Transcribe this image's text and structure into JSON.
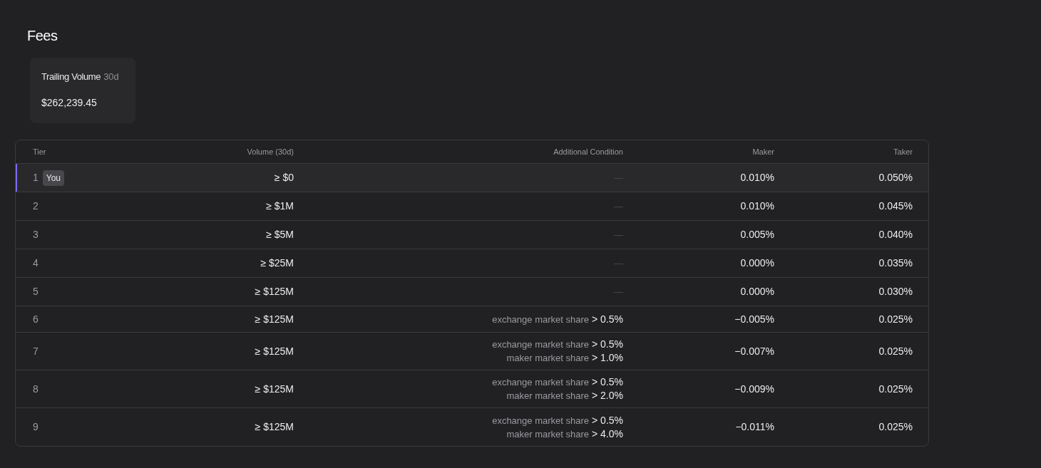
{
  "title": "Fees",
  "volume_card": {
    "label": "Trailing Volume",
    "period": "30d",
    "value": "$262,239.45"
  },
  "table": {
    "columns": [
      "Tier",
      "Volume (30d)",
      "Additional Condition",
      "Maker",
      "Taker"
    ],
    "rows": [
      {
        "tier": "1",
        "badge": "You",
        "selected": true,
        "volume": "≥ $0",
        "condition": "—",
        "conditions": [],
        "maker": "0.010%",
        "taker": "0.050%"
      },
      {
        "tier": "2",
        "selected": false,
        "volume": "≥ $1M",
        "condition": "—",
        "conditions": [],
        "maker": "0.010%",
        "taker": "0.045%"
      },
      {
        "tier": "3",
        "selected": false,
        "volume": "≥ $5M",
        "condition": "—",
        "conditions": [],
        "maker": "0.005%",
        "taker": "0.040%"
      },
      {
        "tier": "4",
        "selected": false,
        "volume": "≥ $25M",
        "condition": "—",
        "conditions": [],
        "maker": "0.000%",
        "taker": "0.035%"
      },
      {
        "tier": "5",
        "selected": false,
        "volume": "≥ $125M",
        "condition": "—",
        "conditions": [],
        "maker": "0.000%",
        "taker": "0.030%"
      },
      {
        "tier": "6",
        "selected": false,
        "volume": "≥ $125M",
        "conditions": [
          {
            "label": "exchange market share",
            "value": "> 0.5%"
          }
        ],
        "maker": "−0.005%",
        "taker": "0.025%"
      },
      {
        "tier": "7",
        "selected": false,
        "volume": "≥ $125M",
        "conditions": [
          {
            "label": "exchange market share",
            "value": "> 0.5%"
          },
          {
            "label": "maker market share",
            "value": "> 1.0%"
          }
        ],
        "maker": "−0.007%",
        "taker": "0.025%"
      },
      {
        "tier": "8",
        "selected": false,
        "volume": "≥ $125M",
        "conditions": [
          {
            "label": "exchange market share",
            "value": "> 0.5%"
          },
          {
            "label": "maker market share",
            "value": "> 2.0%"
          }
        ],
        "maker": "−0.009%",
        "taker": "0.025%"
      },
      {
        "tier": "9",
        "selected": false,
        "volume": "≥ $125M",
        "conditions": [
          {
            "label": "exchange market share",
            "value": "> 0.5%"
          },
          {
            "label": "maker market share",
            "value": "> 4.0%"
          }
        ],
        "maker": "−0.011%",
        "taker": "0.025%"
      }
    ]
  }
}
